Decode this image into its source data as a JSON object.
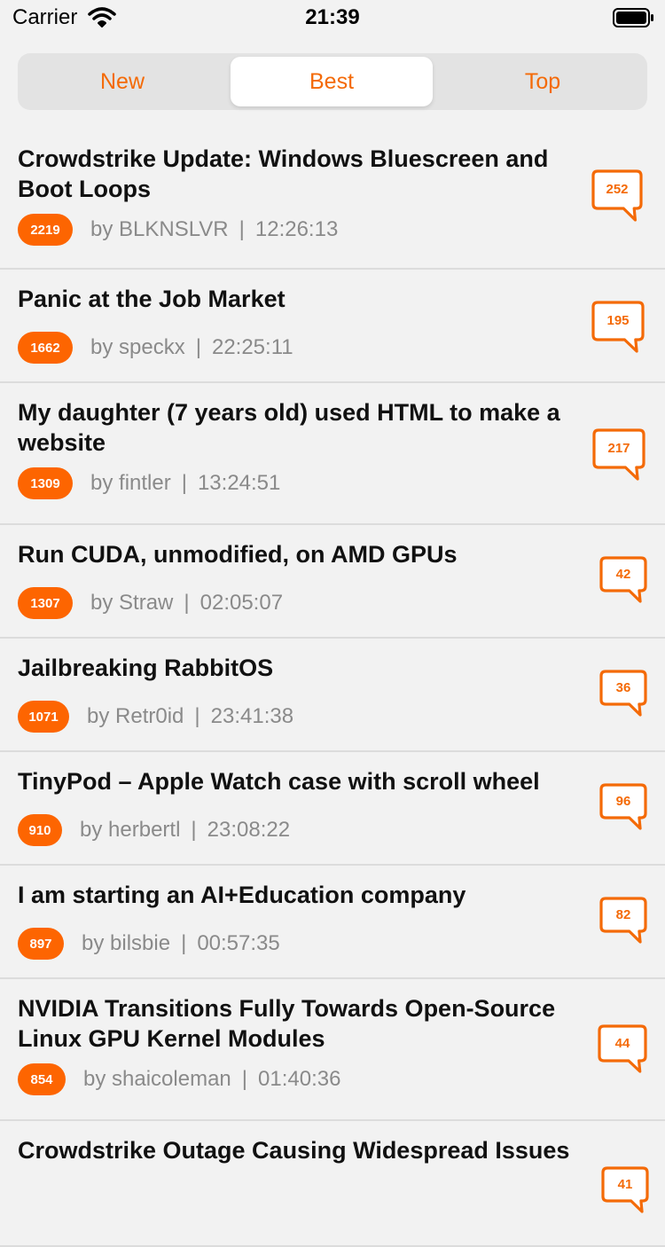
{
  "status_bar": {
    "carrier": "Carrier",
    "time": "21:39"
  },
  "tabs": [
    {
      "label": "New",
      "selected": false
    },
    {
      "label": "Best",
      "selected": true
    },
    {
      "label": "Top",
      "selected": false
    }
  ],
  "stories": [
    {
      "title": "Crowdstrike Update: Windows Bluescreen and Boot Loops",
      "points": "2219",
      "author": "BLKNSLVR",
      "time": "12:26:13",
      "comments": "252"
    },
    {
      "title": "Panic at the Job Market",
      "points": "1662",
      "author": "speckx",
      "time": "22:25:11",
      "comments": "195"
    },
    {
      "title": "My daughter (7 years old) used HTML to make a website",
      "points": "1309",
      "author": "fintler",
      "time": "13:24:51",
      "comments": "217"
    },
    {
      "title": "Run CUDA, unmodified, on AMD GPUs",
      "points": "1307",
      "author": "Straw",
      "time": "02:05:07",
      "comments": "42"
    },
    {
      "title": "Jailbreaking RabbitOS",
      "points": "1071",
      "author": "Retr0id",
      "time": "23:41:38",
      "comments": "36"
    },
    {
      "title": "TinyPod – Apple Watch case with scroll wheel",
      "points": "910",
      "author": "herbertl",
      "time": "23:08:22",
      "comments": "96"
    },
    {
      "title": "I am starting an AI+Education company",
      "points": "897",
      "author": "bilsbie",
      "time": "00:57:35",
      "comments": "82"
    },
    {
      "title": "NVIDIA Transitions Fully Towards Open-Source Linux GPU Kernel Modules",
      "points": "854",
      "author": "shaicoleman",
      "time": "01:40:36",
      "comments": "44"
    },
    {
      "title": "Crowdstrike Outage Causing Widespread Issues",
      "points": "",
      "author": "",
      "time": "",
      "comments": "41"
    }
  ],
  "labels": {
    "by": "by",
    "separator": "|"
  },
  "colors": {
    "accent": "#f46a07",
    "points_bg": "#fd6501",
    "background": "#f2f2f2"
  },
  "icons": {
    "wifi": "wifi-icon",
    "battery": "battery-icon",
    "comments": "speech-bubble-icon"
  }
}
